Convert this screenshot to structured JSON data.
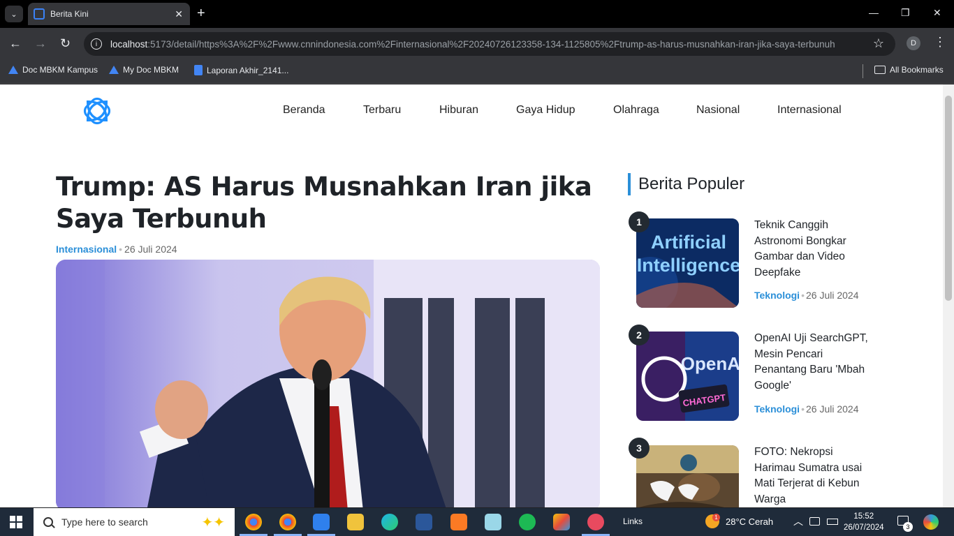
{
  "browser": {
    "tab_title": "Berita Kini",
    "url_host": "localhost",
    "url_rest": ":5173/detail/https%3A%2F%2Fwww.cnnindonesia.com%2Finternasional%2F20240726123358-134-1125805%2Ftrump-as-harus-musnahkan-iran-jika-saya-terbunuh",
    "profile_initial": "D",
    "bookmarks": [
      "Doc MBKM Kampus",
      "My Doc MBKM",
      "Laporan Akhir_2141...",
      "All Bookmarks"
    ]
  },
  "site": {
    "nav": [
      "Beranda",
      "Terbaru",
      "Hiburan",
      "Gaya Hidup",
      "Olahraga",
      "Nasional",
      "Internasional"
    ]
  },
  "article": {
    "title": "Trump: AS Harus Musnahkan Iran jika Saya Terbunuh",
    "category": "Internasional",
    "date": "26 Juli 2024"
  },
  "popular": {
    "heading": "Berita Populer",
    "items": [
      {
        "rank": "1",
        "title": "Teknik Canggih Astronomi Bongkar Gambar dan Video Deepfake",
        "category": "Teknologi",
        "date": "26 Juli 2024",
        "img_text_1": "Artificial",
        "img_text_2": "Intelligence"
      },
      {
        "rank": "2",
        "title": "OpenAI Uji SearchGPT, Mesin Pencari Penantang Baru 'Mbah Google'",
        "category": "Teknologi",
        "date": "26 Juli 2024",
        "img_text_1": "OpenAI",
        "img_text_2": "CHATGPT"
      },
      {
        "rank": "3",
        "title": "FOTO: Nekropsi Harimau Sumatra usai Mati Terjerat di Kebun Warga",
        "category": "",
        "date": ""
      }
    ]
  },
  "taskbar": {
    "search_placeholder": "Type here to search",
    "links_label": "Links",
    "weather": "28°C  Cerah",
    "time": "15:52",
    "date": "26/07/2024",
    "notif_count": "3",
    "weather_badge": "1"
  },
  "colors": {
    "accent": "#2b8fd8",
    "heading": "#1f2328"
  }
}
